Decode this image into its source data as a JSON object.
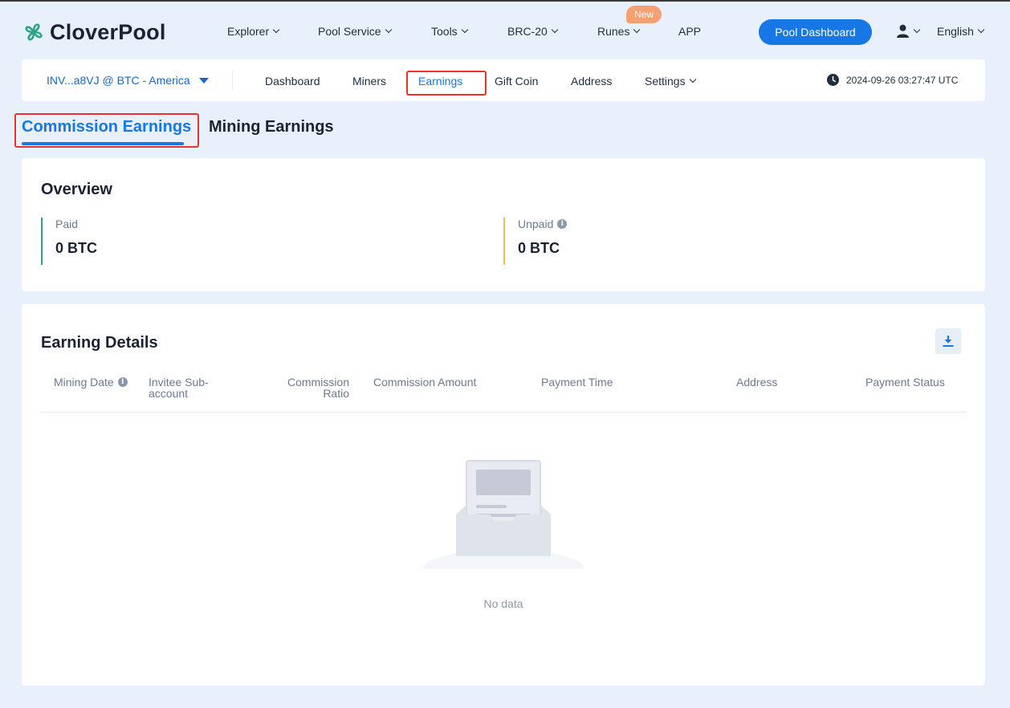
{
  "header": {
    "logo_text": "CloverPool",
    "nav": [
      {
        "label": "Explorer",
        "dropdown": true
      },
      {
        "label": "Pool Service",
        "dropdown": true
      },
      {
        "label": "Tools",
        "dropdown": true
      },
      {
        "label": "BRC-20",
        "dropdown": true
      },
      {
        "label": "Runes",
        "dropdown": true,
        "badge": "New"
      },
      {
        "label": "APP",
        "dropdown": false
      }
    ],
    "pool_dashboard_button": "Pool Dashboard",
    "language": "English",
    "user_icon": "user-icon"
  },
  "subnav": {
    "account": "INV...a8VJ @ BTC - America",
    "items": [
      {
        "label": "Dashboard"
      },
      {
        "label": "Miners"
      },
      {
        "label": "Earnings",
        "active": true
      },
      {
        "label": "Gift Coin"
      },
      {
        "label": "Address"
      },
      {
        "label": "Settings",
        "dropdown": true
      }
    ],
    "datetime": "2024-09-26 03:27:47 UTC"
  },
  "tabs": {
    "commission": "Commission Earnings",
    "mining": "Mining Earnings",
    "active": "Commission Earnings"
  },
  "overview": {
    "title": "Overview",
    "paid_label": "Paid",
    "paid_value": "0 BTC",
    "unpaid_label": "Unpaid",
    "unpaid_value": "0 BTC"
  },
  "details": {
    "title": "Earning Details",
    "columns": {
      "mining_date": "Mining Date",
      "invitee_sub_account_l1": "Invitee Sub-",
      "invitee_sub_account_l2": "account",
      "commission_ratio_l1": "Commission",
      "commission_ratio_l2": "Ratio",
      "commission_amount": "Commission Amount",
      "payment_time": "Payment Time",
      "address": "Address",
      "payment_status": "Payment Status"
    },
    "empty_text": "No data"
  },
  "colors": {
    "primary": "#1677e5",
    "badge": "#f5a072",
    "highlight_box": "#e8322b",
    "paid_accent": "#2fa38a",
    "unpaid_accent": "#e8c04a",
    "page_bg": "#e8f1fb"
  }
}
